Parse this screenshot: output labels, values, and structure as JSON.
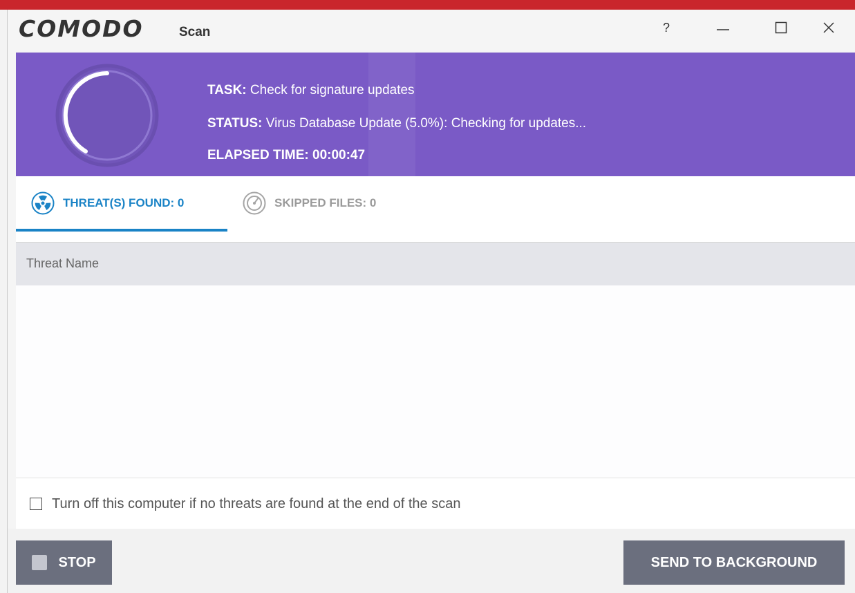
{
  "window": {
    "logo": "COMODO",
    "title": "Scan",
    "controls": {
      "help": "?",
      "minimize": "—",
      "maximize": "☐",
      "close": "✕"
    }
  },
  "banner": {
    "background_color": "#7a5ac6",
    "task_label": "TASK:",
    "task_value": " Check for signature updates",
    "status_label": "STATUS:",
    "status_value": " Virus Database Update (5.0%): Checking for updates...",
    "elapsed_label": "ELAPSED TIME:",
    "elapsed_value": " 00:00:47",
    "spinner_icon": "progress-ring-icon"
  },
  "tabs": [
    {
      "label": "THREAT(S) FOUND: 0",
      "icon": "radiation-icon",
      "active": true
    },
    {
      "label": "SKIPPED FILES: 0",
      "icon": "skip-gauge-icon",
      "active": false
    }
  ],
  "table": {
    "columns": [
      "Threat Name"
    ],
    "rows": []
  },
  "options": {
    "shutdown_label": "Turn off this computer if no threats are found at the end of the scan",
    "shutdown_checked": false
  },
  "footer": {
    "stop_label": "STOP",
    "background_label": "SEND TO BACKGROUND"
  },
  "colors": {
    "brand_red": "#c9262c",
    "accent_blue": "#1a83c6",
    "button_gray": "#6b6f7e"
  }
}
